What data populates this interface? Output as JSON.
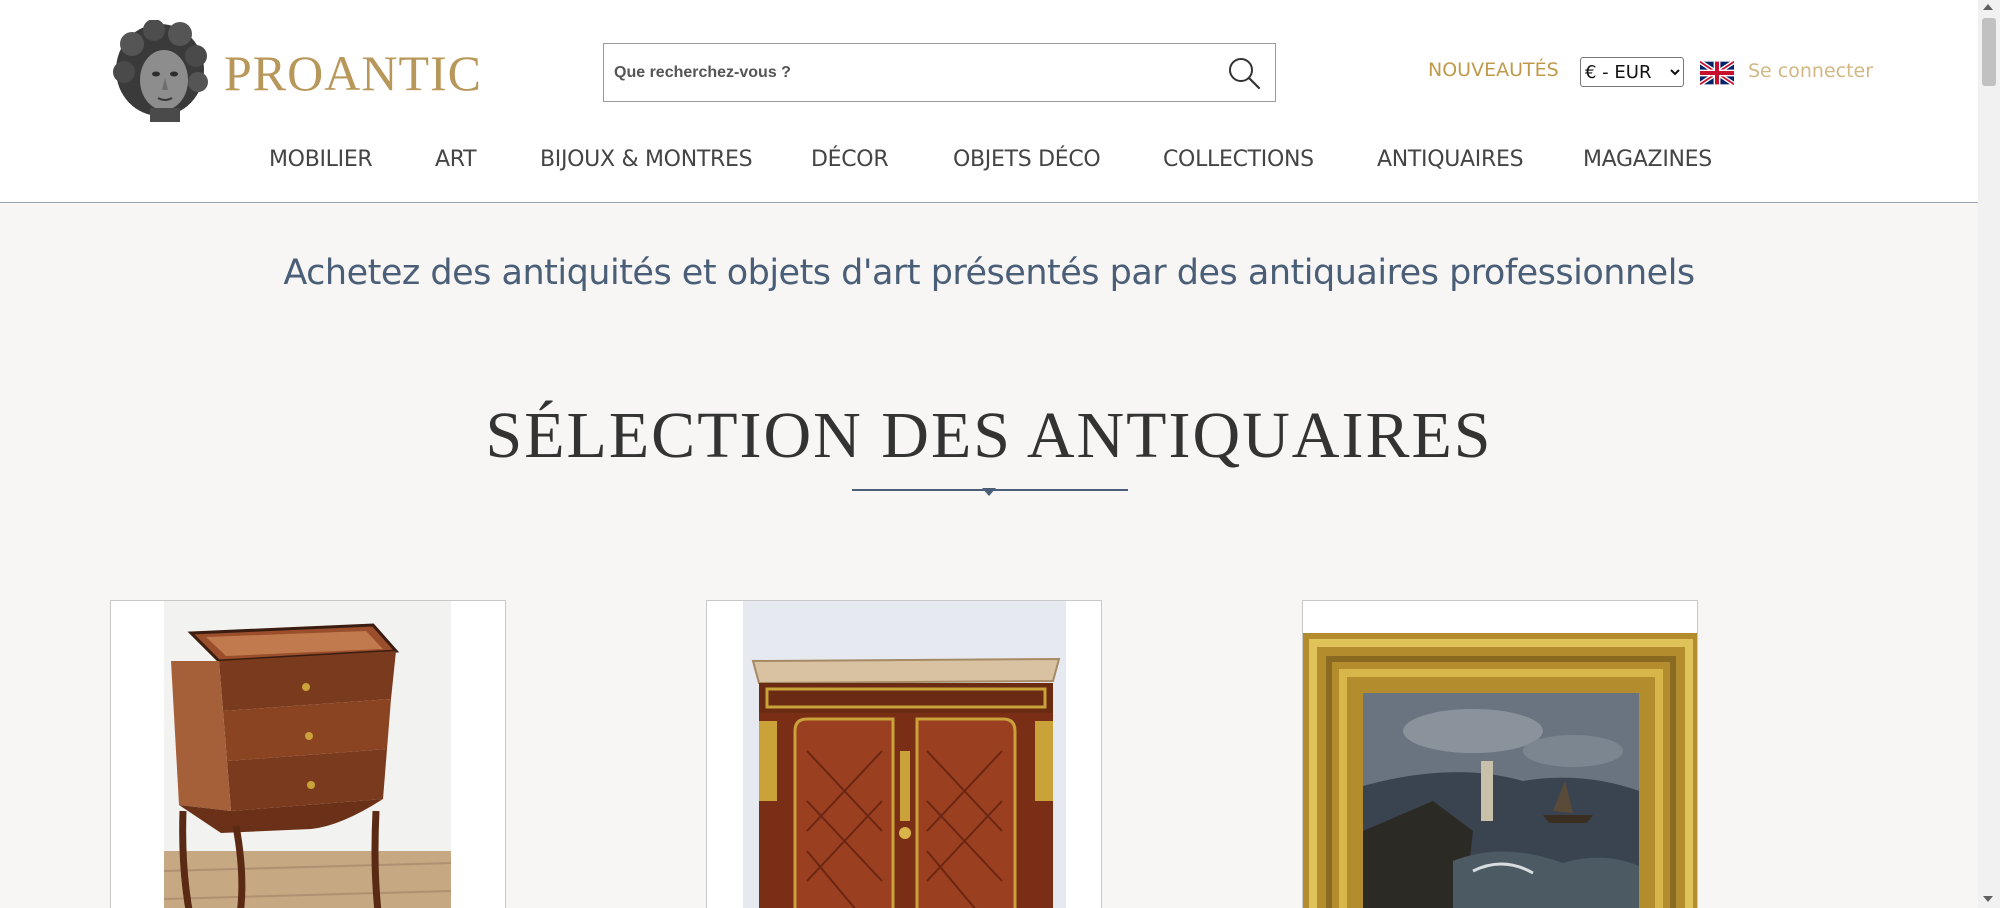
{
  "header": {
    "logo_text": "PROANTIC",
    "search": {
      "placeholder": "Que recherchez-vous ?",
      "value": "",
      "icon": "search-icon"
    },
    "news_label": "NOUVEAUTÉS",
    "currency": {
      "selected": "€ - EUR"
    },
    "language_flag": "uk-flag-icon",
    "login_label": "Se connecter"
  },
  "nav": {
    "items": [
      {
        "label": "MOBILIER"
      },
      {
        "label": "ART"
      },
      {
        "label": "BIJOUX & MONTRES"
      },
      {
        "label": "DÉCOR"
      },
      {
        "label": "OBJETS DÉCO"
      },
      {
        "label": "COLLECTIONS"
      },
      {
        "label": "ANTIQUAIRES"
      },
      {
        "label": "MAGAZINES"
      }
    ]
  },
  "main": {
    "tagline": "Achetez des antiquités et objets d'art présentés par des antiquaires professionnels",
    "section_title": "SÉLECTION DES ANTIQUAIRES",
    "products": [
      {
        "image": "side-table-photo"
      },
      {
        "image": "commode-cabinet-photo"
      },
      {
        "image": "framed-seascape-painting-photo"
      }
    ]
  },
  "colors": {
    "brand_gold": "#b8975a",
    "nav_text": "#444444",
    "tagline_blue": "#4a5e78",
    "page_background": "#f7f6f4"
  }
}
